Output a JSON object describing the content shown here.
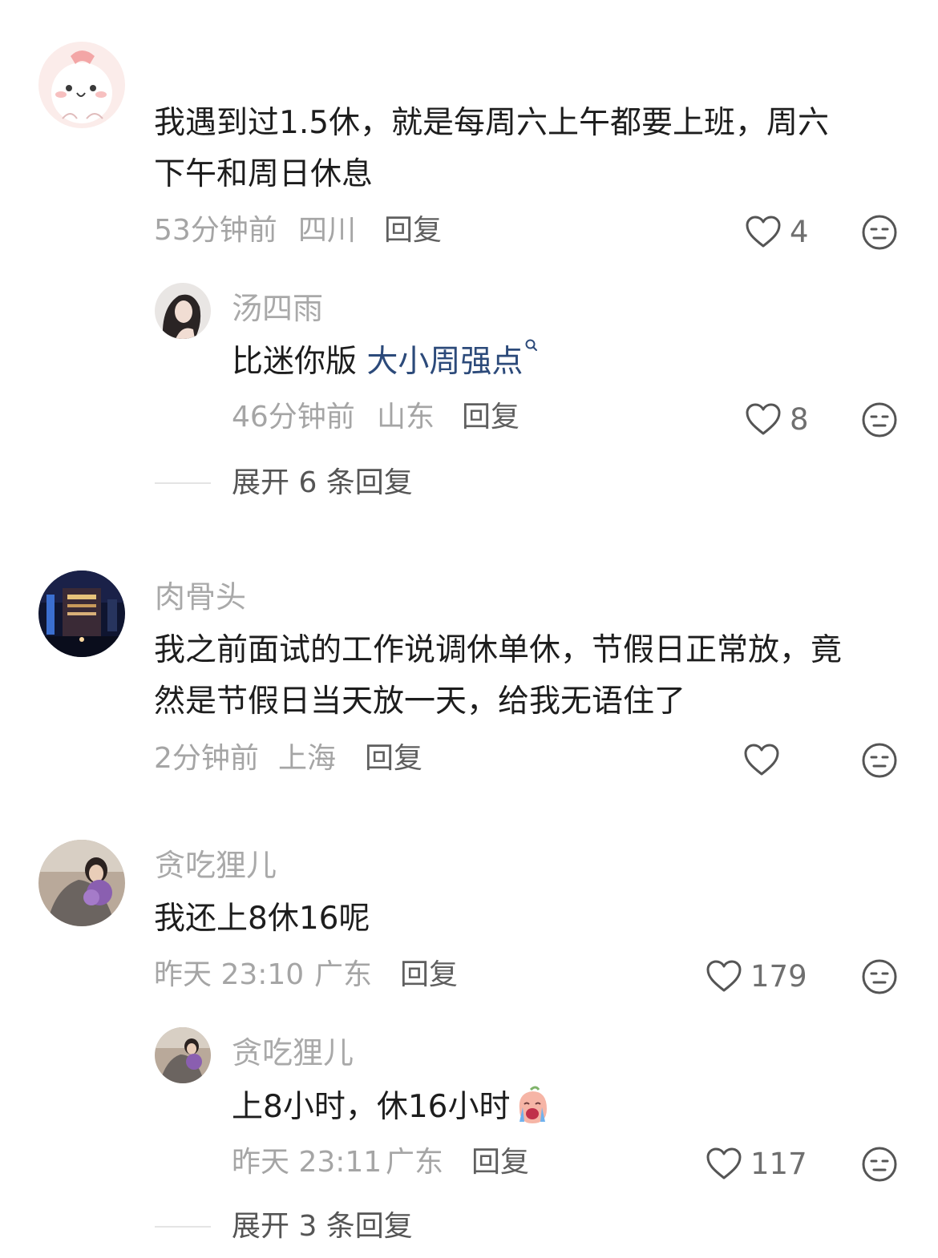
{
  "comments": [
    {
      "username": "",
      "text_lines": [
        "我遇到过1.5休，就是每周六上午都要上班，周六",
        "下午和周日休息"
      ],
      "time": "53分钟前",
      "location": "四川",
      "reply_label": "回复",
      "likes": "4",
      "replies": [
        {
          "username": "汤四雨",
          "text_prefix": "比迷你版 ",
          "text_link": "大小周强点",
          "time": "46分钟前",
          "location": "山东",
          "reply_label": "回复",
          "likes": "8"
        }
      ],
      "expand_label": "展开 6 条回复"
    },
    {
      "username": "肉骨头",
      "text_lines": [
        "我之前面试的工作说调休单休，节假日正常放，竟",
        "然是节假日当天放一天，给我无语住了"
      ],
      "time": "2分钟前",
      "location": "上海",
      "reply_label": "回复",
      "likes": ""
    },
    {
      "username": "贪吃狸儿",
      "text_lines": [
        "我还上8休16呢"
      ],
      "time": "昨天 23:10",
      "location": "广东",
      "reply_label": "回复",
      "likes": "179",
      "replies": [
        {
          "username": "贪吃狸儿",
          "text": "上8小时，休16小时",
          "emoji": "crying-face-emoji",
          "time": "昨天 23:11",
          "location": "广东",
          "reply_label": "回复",
          "likes": "117"
        }
      ],
      "expand_label": "展开 3 条回复"
    }
  ],
  "icons": {
    "like": "heart-outline-icon",
    "dislike": "neutral-face-icon"
  },
  "colors": {
    "link": "#2c4a7a",
    "username": "#a9a9a9",
    "meta": "#a5a5a5"
  }
}
